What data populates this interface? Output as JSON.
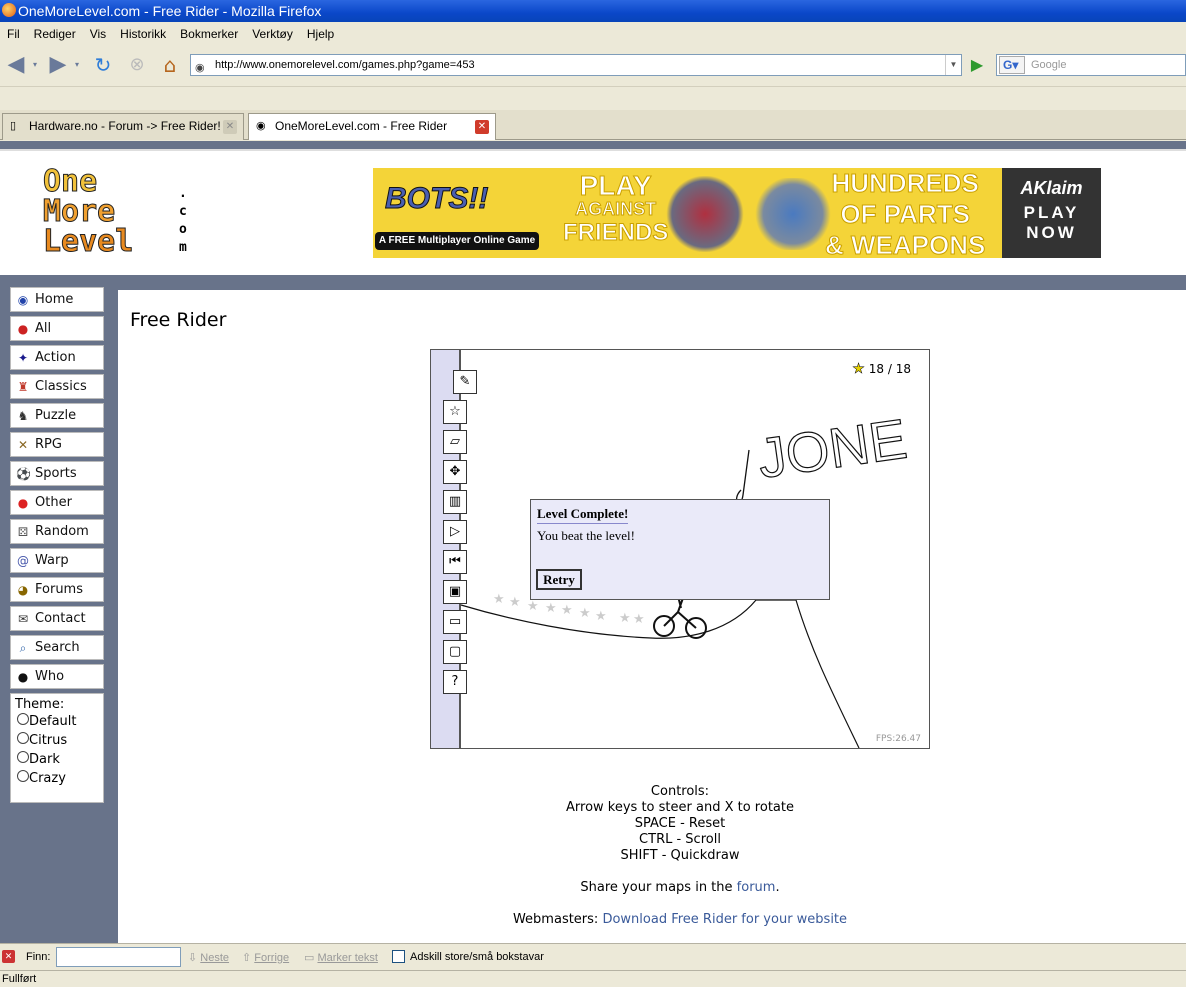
{
  "window": {
    "title": "OneMoreLevel.com - Free Rider - Mozilla Firefox"
  },
  "menu": [
    "Fil",
    "Rediger",
    "Vis",
    "Historikk",
    "Bokmerker",
    "Verktøy",
    "Hjelp"
  ],
  "address": {
    "url": "http://www.onemorelevel.com/games.php?game=453"
  },
  "search": {
    "placeholder": "Google"
  },
  "tabs": [
    {
      "label": "Hardware.no - Forum -> Free Rider! -...",
      "active": false
    },
    {
      "label": "OneMoreLevel.com - Free Rider",
      "active": true
    }
  ],
  "logo": {
    "lines": [
      "One",
      "More",
      "Level"
    ],
    "suffix": ".com"
  },
  "banner": {
    "brand": "BOTS!!",
    "brand_sub": "A FREE Multiplayer Online Game",
    "play": [
      "PLAY",
      "AGAINST",
      "FRIENDS"
    ],
    "hundreds": [
      "HUNDREDS",
      "OF PARTS",
      "& WEAPONS"
    ],
    "akklaim": "AKlaim",
    "cta": [
      "PLAY",
      "NOW"
    ]
  },
  "sidebar": {
    "items": [
      {
        "label": "Home",
        "icon": "home-icon",
        "glyph": "◉",
        "color": "#2244aa"
      },
      {
        "label": "All",
        "icon": "cherry-icon",
        "glyph": "●",
        "color": "#cc2222"
      },
      {
        "label": "Action",
        "icon": "action-icon",
        "glyph": "✦",
        "color": "#1a1a8c"
      },
      {
        "label": "Classics",
        "icon": "mario-icon",
        "glyph": "♜",
        "color": "#c0392b"
      },
      {
        "label": "Puzzle",
        "icon": "puzzle-icon",
        "glyph": "♞",
        "color": "#333333"
      },
      {
        "label": "RPG",
        "icon": "sword-icon",
        "glyph": "✕",
        "color": "#886622"
      },
      {
        "label": "Sports",
        "icon": "soccer-ball-icon",
        "glyph": "⚽",
        "color": "#222222"
      },
      {
        "label": "Other",
        "icon": "ghost-icon",
        "glyph": "●",
        "color": "#dd2222"
      },
      {
        "label": "Random",
        "icon": "dice-icon",
        "glyph": "⚄",
        "color": "#555555"
      },
      {
        "label": "Warp",
        "icon": "spiral-icon",
        "glyph": "@",
        "color": "#4455aa"
      },
      {
        "label": "Forums",
        "icon": "pacman-icon",
        "glyph": "◕",
        "color": "#886600"
      },
      {
        "label": "Contact",
        "icon": "envelope-icon",
        "glyph": "✉",
        "color": "#333333"
      },
      {
        "label": "Search",
        "icon": "magnifier-icon",
        "glyph": "⌕",
        "color": "#3366aa"
      },
      {
        "label": "Who",
        "icon": "person-icon",
        "glyph": "●",
        "color": "#111111"
      }
    ],
    "theme": {
      "label": "Theme:",
      "options": [
        "Default",
        "Citrus",
        "Dark",
        "Crazy"
      ]
    }
  },
  "main": {
    "title": "Free Rider"
  },
  "game": {
    "stars": "18 / 18",
    "fps": "FPS:26.47",
    "graffiti": "JONE",
    "dialog": {
      "title": "Level Complete!",
      "message": "You beat the level!",
      "button": "Retry"
    },
    "tools": [
      {
        "name": "pencil-tool-icon",
        "glyph": "✎"
      },
      {
        "name": "star-tool-icon",
        "glyph": "☆"
      },
      {
        "name": "eraser-tool-icon",
        "glyph": "▱"
      },
      {
        "name": "move-tool-icon",
        "glyph": "✥"
      },
      {
        "name": "trash-tool-icon",
        "glyph": "▥"
      },
      {
        "name": "play-tool-icon",
        "glyph": "▷"
      },
      {
        "name": "restart-tool-icon",
        "glyph": "⏮"
      },
      {
        "name": "save-tool-icon",
        "glyph": "▣"
      },
      {
        "name": "open-tool-icon",
        "glyph": "▭"
      },
      {
        "name": "new-tool-icon",
        "glyph": "▢"
      },
      {
        "name": "help-tool-icon",
        "glyph": "?"
      }
    ]
  },
  "controls": {
    "heading": "Controls:",
    "lines": [
      "Arrow keys to steer and X to rotate",
      "SPACE - Reset",
      "CTRL - Scroll",
      "SHIFT - Quickdraw"
    ]
  },
  "share": {
    "prefix": "Share your maps in the",
    "link": "forum",
    "suffix": "."
  },
  "webmasters": {
    "prefix": "Webmasters:",
    "link": "Download Free Rider for your website"
  },
  "findbar": {
    "label": "Finn:",
    "next": "Neste",
    "prev": "Forrige",
    "highlight": "Marker tekst",
    "matchcase": "Adskill store/små bokstavar"
  },
  "status": "Fullført"
}
